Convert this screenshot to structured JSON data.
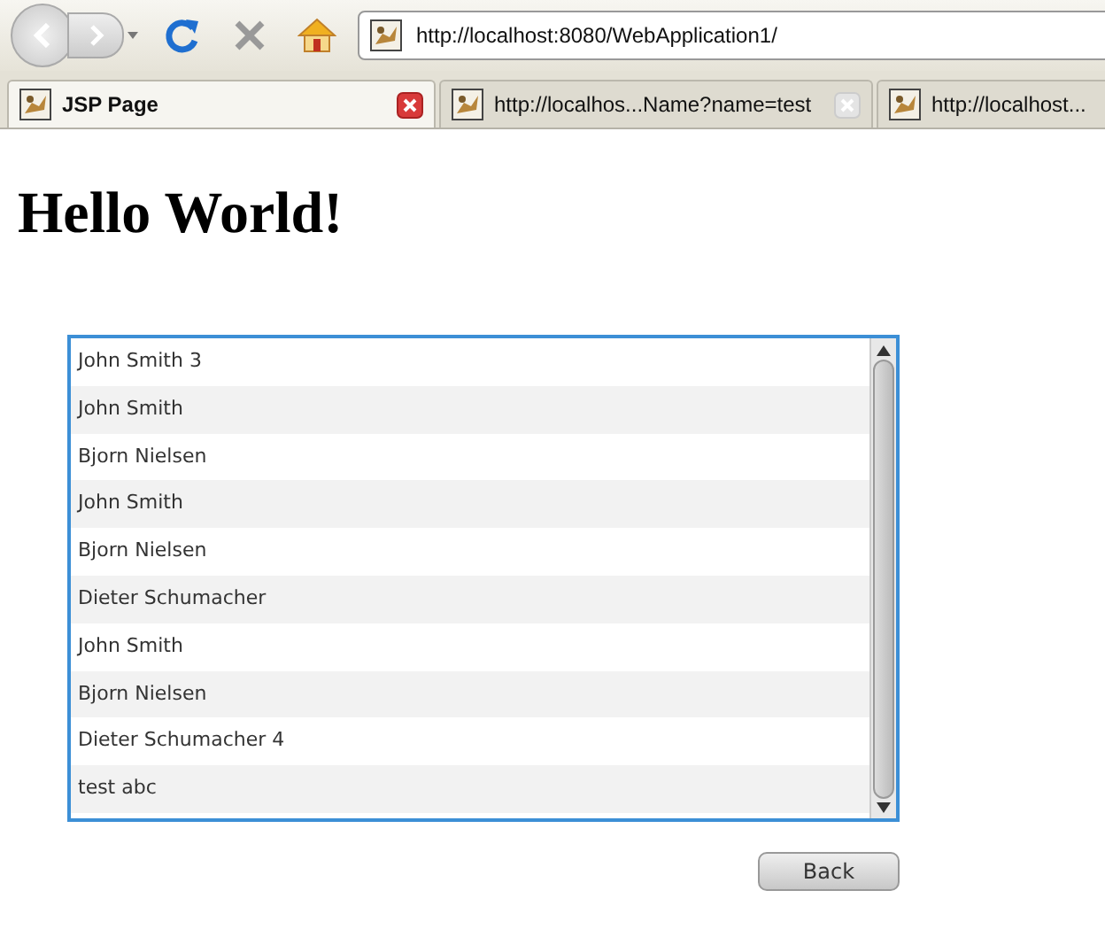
{
  "toolbar": {
    "url": "http://localhost:8080/WebApplication1/"
  },
  "tabs": [
    {
      "label": "JSP Page",
      "selected": true
    },
    {
      "label": "http://localhos...Name?name=test",
      "selected": false
    },
    {
      "label": "http://localhost...",
      "selected": false
    }
  ],
  "page": {
    "heading": "Hello World!",
    "list": [
      "John Smith 3",
      "John Smith",
      "Bjorn Nielsen",
      "John Smith",
      "Bjorn Nielsen",
      "Dieter Schumacher",
      "John Smith",
      "Bjorn Nielsen",
      "Dieter Schumacher 4",
      "test abc"
    ],
    "button": "Back"
  }
}
